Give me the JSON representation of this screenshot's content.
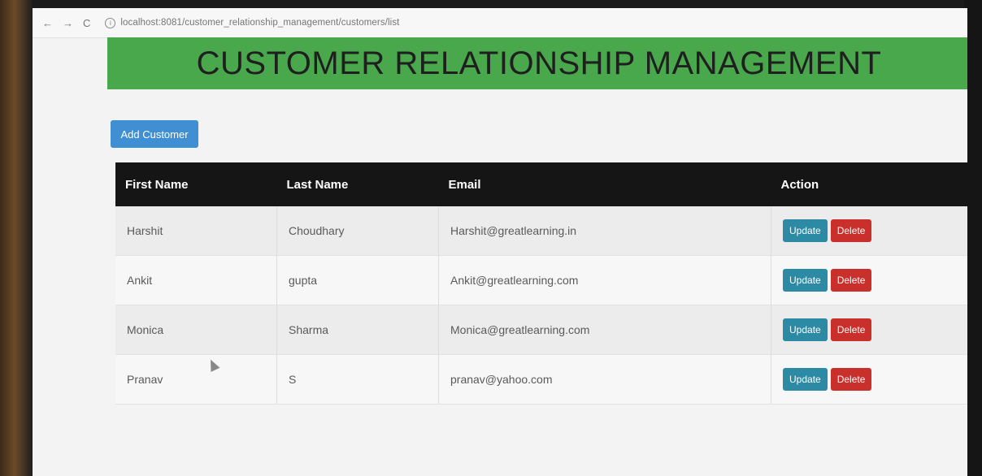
{
  "browser": {
    "back_icon": "←",
    "forward_icon": "→",
    "reload_icon": "C",
    "info_icon": "i",
    "url": "localhost:8081/customer_relationship_management/customers/list"
  },
  "header": {
    "title": "CUSTOMER RELATIONSHIP MANAGEMENT"
  },
  "toolbar": {
    "add_label": "Add Customer"
  },
  "table": {
    "columns": [
      "First Name",
      "Last Name",
      "Email",
      "Action"
    ],
    "rows": [
      {
        "first": "Harshit",
        "last": "Choudhary",
        "email": "Harshit@greatlearning.in"
      },
      {
        "first": "Ankit",
        "last": "gupta",
        "email": "Ankit@greatlearning.com"
      },
      {
        "first": "Monica",
        "last": "Sharma",
        "email": "Monica@greatlearning.com"
      },
      {
        "first": "Pranav",
        "last": "S",
        "email": "pranav@yahoo.com"
      }
    ],
    "update_label": "Update",
    "delete_label": "Delete"
  },
  "colors": {
    "banner": "#4aa84c",
    "add_button": "#3f8fd2",
    "update_button": "#2d8aa4",
    "delete_button": "#c9302c",
    "table_header": "#151515"
  }
}
